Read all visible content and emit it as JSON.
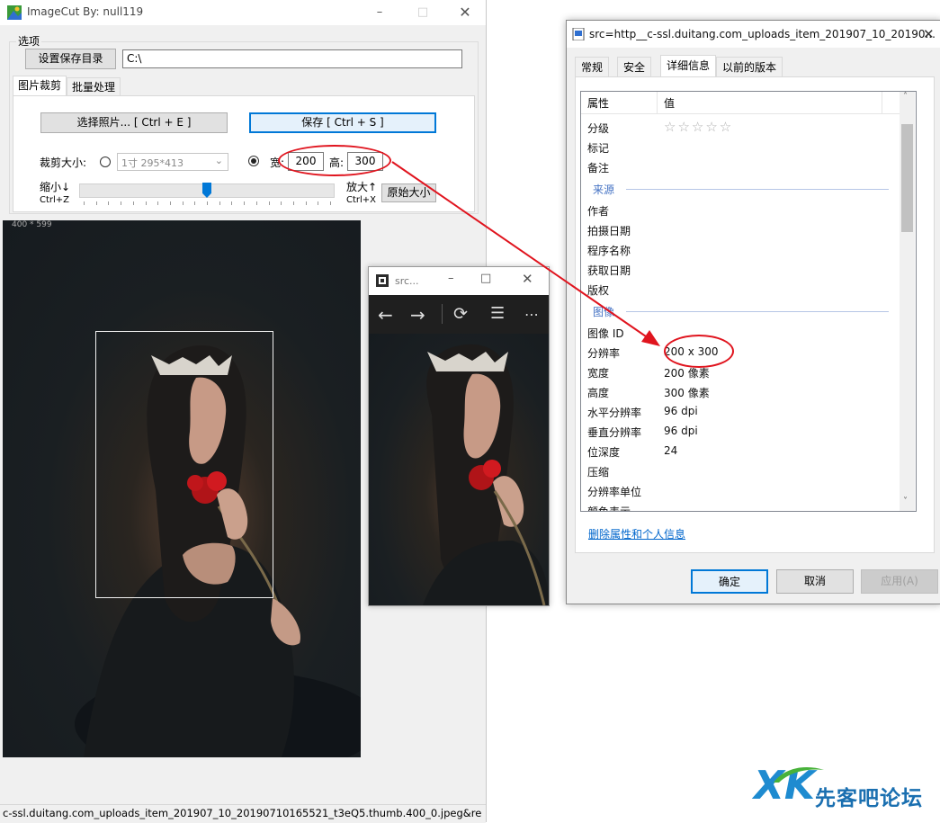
{
  "imagecut": {
    "title": "ImageCut   By: null119",
    "group_label": "选项",
    "set_dir_button": "设置保存目录",
    "dir_value": "C:\\",
    "tabs": [
      "图片裁剪",
      "批量处理"
    ],
    "select_photo_button": "选择照片... [ Ctrl + E ]",
    "save_button": "保存 [ Ctrl + S ]",
    "crop_size_label": "裁剪大小:",
    "preset_option": "1寸  295*413",
    "width_label": "宽:",
    "width_value": "200",
    "height_label": "高:",
    "height_value": "300",
    "zoom_out_label": "缩小↓",
    "zoom_out_shortcut": "Ctrl+Z",
    "zoom_in_label": "放大↑",
    "zoom_in_shortcut": "Ctrl+X",
    "original_size_button": "原始大小",
    "image_dims": "400 * 599",
    "slider_level": 0.5,
    "status": "c-ssl.duitang.com_uploads_item_201907_10_20190710165521_t3eQ5.thumb.400_0.jpeg&re"
  },
  "viewer": {
    "title": "src..."
  },
  "properties": {
    "title": "src=http__c-ssl.duitang.com_uploads_item_201907_10_20190...",
    "tabs": [
      "常规",
      "安全",
      "详细信息",
      "以前的版本"
    ],
    "col_property": "属性",
    "col_value": "值",
    "rows_top": [
      {
        "label": "分级",
        "value": ""
      },
      {
        "label": "标记",
        "value": ""
      },
      {
        "label": "备注",
        "value": ""
      }
    ],
    "rating_stars": "☆☆☆☆☆",
    "section_source": "来源",
    "rows_source": [
      {
        "label": "作者",
        "value": ""
      },
      {
        "label": "拍摄日期",
        "value": ""
      },
      {
        "label": "程序名称",
        "value": ""
      },
      {
        "label": "获取日期",
        "value": ""
      },
      {
        "label": "版权",
        "value": ""
      }
    ],
    "section_image": "图像",
    "rows_image": [
      {
        "label": "图像 ID",
        "value": ""
      },
      {
        "label": "分辨率",
        "value": "200 x 300"
      },
      {
        "label": "宽度",
        "value": "200 像素"
      },
      {
        "label": "高度",
        "value": "300 像素"
      },
      {
        "label": "水平分辨率",
        "value": "96 dpi"
      },
      {
        "label": "垂直分辨率",
        "value": "96 dpi"
      },
      {
        "label": "位深度",
        "value": "24"
      },
      {
        "label": "压缩",
        "value": ""
      },
      {
        "label": "分辨率单位",
        "value": ""
      },
      {
        "label": "颜色表示",
        "value": ""
      }
    ],
    "remove_link": "删除属性和个人信息",
    "ok_button": "确定",
    "cancel_button": "取消",
    "apply_button": "应用(A)"
  },
  "watermark": {
    "logo": "XK",
    "text": "先客吧论坛"
  },
  "colors": {
    "accent": "#0078d7",
    "annotation_red": "#e0141e",
    "link_blue": "#0066cc"
  }
}
